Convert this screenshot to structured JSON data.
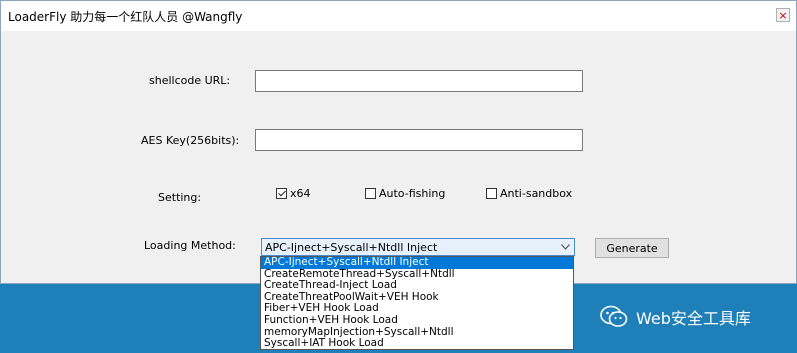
{
  "window": {
    "title": "LoaderFly 助力每一个红队人员 @Wangfly",
    "close_label": "×"
  },
  "form": {
    "shellcode_label": "shellcode URL:",
    "shellcode_value": "",
    "aes_label": "AES Key(256bits):",
    "aes_value": "",
    "setting_label": "Setting:",
    "options": [
      {
        "label": "x64",
        "checked": true
      },
      {
        "label": "Auto-fishing",
        "checked": false
      },
      {
        "label": "Anti-sandbox",
        "checked": false
      }
    ],
    "loading_label": "Loading Method:",
    "loading_selected": "APC-Ijnect+Syscall+Ntdll Inject",
    "loading_options": [
      "APC-Ijnect+Syscall+Ntdll Inject",
      "CreateRemoteThread+Syscall+Ntdll",
      "CreateThread-Inject Load",
      "CreateThreatPoolWait+VEH Hook",
      "Fiber+VEH Hook Load",
      "Function+VEH Hook Load",
      "memoryMapInjection+Syscall+Ntdll",
      "Syscall+IAT Hook Load"
    ],
    "generate_label": "Generate"
  },
  "watermark": {
    "text": "Web安全工具库",
    "logo_icon": "wechat-icon"
  },
  "colors": {
    "desktop": "#1f7fb8",
    "selection": "#0078d7"
  }
}
